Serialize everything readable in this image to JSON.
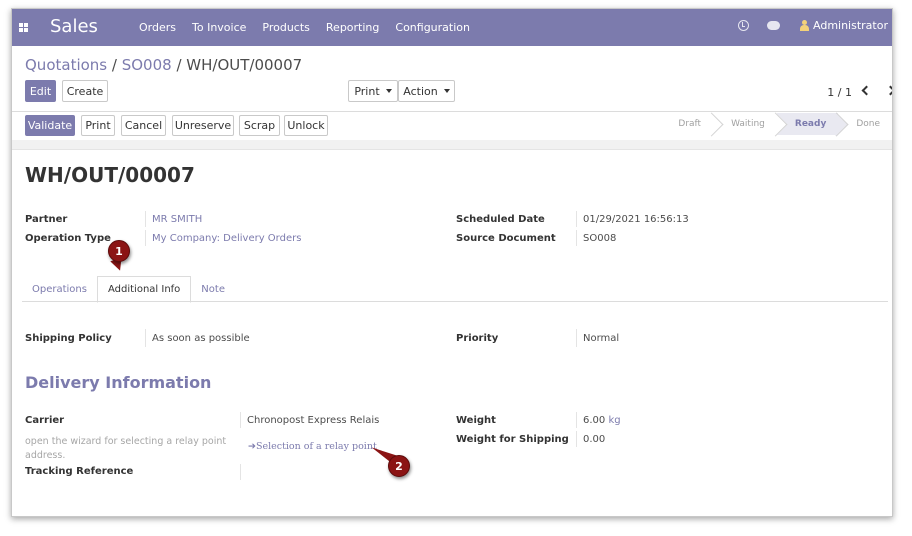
{
  "navbar": {
    "app_name": "Sales",
    "menu": [
      "Orders",
      "To Invoice",
      "Products",
      "Reporting",
      "Configuration"
    ],
    "user": "Administrator",
    "color": "#7c7bad"
  },
  "breadcrumb": {
    "part1": "Quotations",
    "sep1": " / ",
    "part2": "SO008",
    "sep2": " / ",
    "current": "WH/OUT/00007"
  },
  "toolbar": {
    "edit": "Edit",
    "create": "Create",
    "print": "Print",
    "action": "Action",
    "pager": "1 / 1"
  },
  "actions": {
    "validate": "Validate",
    "print": "Print",
    "cancel": "Cancel",
    "unreserve": "Unreserve",
    "scrap": "Scrap",
    "unlock": "Unlock"
  },
  "status": {
    "stages": [
      "Draft",
      "Waiting",
      "Ready",
      "Done"
    ],
    "active": "Ready"
  },
  "record": {
    "title": "WH/OUT/00007",
    "partner_label": "Partner",
    "partner": "MR SMITH",
    "operation_type_label": "Operation Type",
    "operation_type": "My Company: Delivery Orders",
    "scheduled_date_label": "Scheduled Date",
    "scheduled_date": "01/29/2021 16:56:13",
    "source_document_label": "Source Document",
    "source_document": "SO008"
  },
  "tabs": [
    "Operations",
    "Additional Info",
    "Note"
  ],
  "active_tab": "Additional Info",
  "additional_info": {
    "shipping_policy_label": "Shipping Policy",
    "shipping_policy": "As soon as possible",
    "priority_label": "Priority",
    "priority": "Normal",
    "section_title": "Delivery Information",
    "carrier_label": "Carrier",
    "carrier": "Chronopost Express Relais",
    "carrier_help": "open the wizard for selecting a relay point address.",
    "relay_link": "Selection of a relay point",
    "tracking_label": "Tracking Reference",
    "weight_label": "Weight",
    "weight": "6.00",
    "weight_unit": "kg",
    "shipping_weight_label": "Weight for Shipping",
    "shipping_weight": "0.00"
  },
  "callouts": {
    "one": "1",
    "two": "2"
  }
}
